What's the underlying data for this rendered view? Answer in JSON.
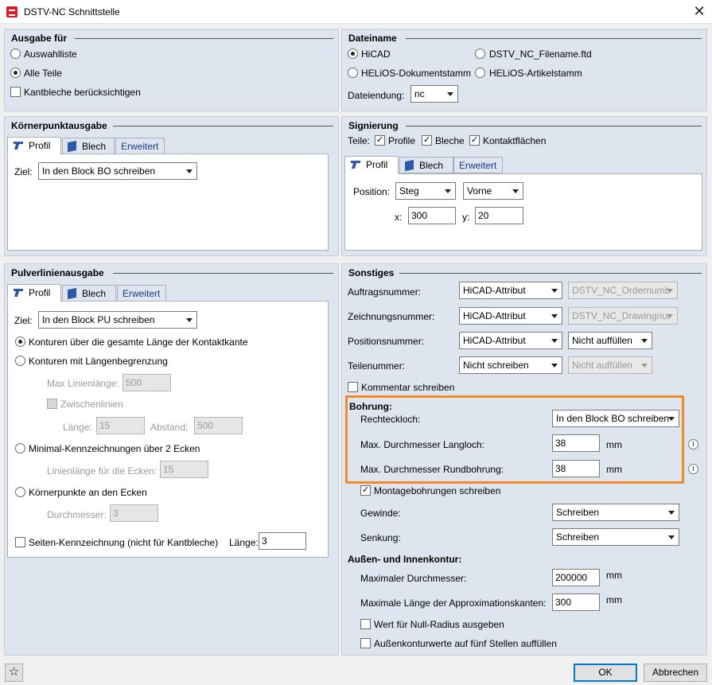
{
  "window": {
    "title": "DSTV-NC Schnittstelle",
    "close": "✕"
  },
  "ausgabe": {
    "title": "Ausgabe für",
    "opt1": "Auswahlliste",
    "opt2": "Alle Teile",
    "kantbleche": "Kantbleche berücksichtigen"
  },
  "dateiname": {
    "title": "Dateiname",
    "opt_hicad": "HiCAD",
    "opt_dstv": "DSTV_NC_Filename.ftd",
    "opt_helios_dok": "HELiOS-Dokumentstamm",
    "opt_helios_art": "HELiOS-Artikelstamm",
    "endung_label": "Dateiendung:",
    "endung_value": "nc"
  },
  "koerner": {
    "title": "Körnerpunktausgabe",
    "tab_profil": "Profil",
    "tab_blech": "Blech",
    "tab_erweitert": "Erweitert",
    "ziel_label": "Ziel:",
    "ziel_value": "In den Block BO schreiben"
  },
  "signierung": {
    "title": "Signierung",
    "teile_label": "Teile:",
    "cb_profile": "Profile",
    "cb_bleche": "Bleche",
    "cb_kontakt": "Kontaktflächen",
    "tab_profil": "Profil",
    "tab_blech": "Blech",
    "tab_erweitert": "Erweitert",
    "position_label": "Position:",
    "pos1": "Steg",
    "pos2": "Vorne",
    "x_label": "x:",
    "x_value": "300",
    "y_label": "y:",
    "y_value": "20"
  },
  "pulver": {
    "title": "Pulverlinienausgabe",
    "tab_profil": "Profil",
    "tab_blech": "Blech",
    "tab_erweitert": "Erweitert",
    "ziel_label": "Ziel:",
    "ziel_value": "In den Block PU schreiben",
    "r1": "Konturen über die gesamte Länge der Kontaktkante",
    "r2": "Konturen mit Längenbegrenzung",
    "max_label": "Max Linienlänge:",
    "max_value": "500",
    "zwischen": "Zwischenlinien",
    "laenge_label": "Länge:",
    "laenge_value": "15",
    "abstand_label": "Abstand:",
    "abstand_value": "500",
    "r3": "Minimal-Kennzeichnungen über 2 Ecken",
    "ecken_label": "Linienlänge für die Ecken:",
    "ecken_value": "15",
    "r4": "Körnerpunkte an den Ecken",
    "durch_label": "Durchmesser:",
    "durch_value": "3",
    "seiten": "Seiten-Kennzeichnung (nicht für Kantbleche)",
    "seiten_laenge_label": "Länge:",
    "seiten_laenge_value": "3"
  },
  "sonstiges": {
    "title": "Sonstiges",
    "auftrag_label": "Auftragsnummer:",
    "auftrag_c1": "HiCAD-Attribut",
    "auftrag_c2": "DSTV_NC_Ordernumb",
    "zeichnung_label": "Zeichnungsnummer:",
    "zeichnung_c1": "HiCAD-Attribut",
    "zeichnung_c2": "DSTV_NC_Drawingnur",
    "position_label": "Positionsnummer:",
    "position_c1": "HiCAD-Attribut",
    "position_c2": "Nicht auffüllen",
    "teil_label": "Teilenummer:",
    "teil_c1": "Nicht schreiben",
    "teil_c2": "Nicht auffüllen",
    "kommentar": "Kommentar schreiben",
    "bohrung_title": "Bohrung:",
    "rechteck_label": "Rechteckloch:",
    "rechteck_value": "In den Block BO schreiben",
    "lang_label": "Max. Durchmesser Langloch:",
    "lang_value": "38",
    "lang_unit": "mm",
    "rund_label": "Max. Durchmesser Rundbohrung:",
    "rund_value": "38",
    "rund_unit": "mm",
    "montage": "Montagebohrungen schreiben",
    "gewinde_label": "Gewinde:",
    "gewinde_value": "Schreiben",
    "senkung_label": "Senkung:",
    "senkung_value": "Schreiben",
    "kontur_title": "Außen- und Innenkontur:",
    "maxd_label": "Maximaler Durchmesser:",
    "maxd_value": "200000",
    "maxd_unit": "mm",
    "approx_label": "Maximale Länge der Approximationskanten:",
    "approx_value": "300",
    "approx_unit": "mm",
    "null_radius": "Wert für Null-Radius ausgeben",
    "fuenf": "Außenkonturwerte auf fünf Stellen auffüllen"
  },
  "footer": {
    "ok": "OK",
    "abbrechen": "Abbrechen"
  },
  "colors": {
    "highlight": "#f08a2c",
    "group_bg": "#dfe5ee",
    "accent": "#0078d7"
  }
}
